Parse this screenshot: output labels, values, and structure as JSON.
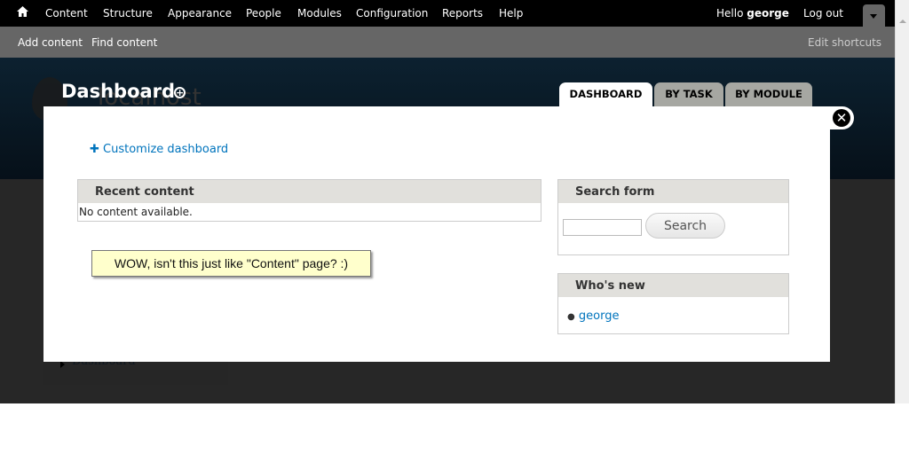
{
  "toolbar": {
    "menu": [
      "Content",
      "Structure",
      "Appearance",
      "People",
      "Modules",
      "Configuration",
      "Reports",
      "Help"
    ],
    "hello": "Hello",
    "username": "george",
    "logout": "Log out"
  },
  "shortcuts": {
    "items": [
      "Add content",
      "Find content"
    ],
    "edit": "Edit shortcuts"
  },
  "header": {
    "title": "Dashboard",
    "site_name": "localhost",
    "tabs": [
      "DASHBOARD",
      "BY TASK",
      "BY MODULE"
    ]
  },
  "background": {
    "breadcrumb": "Dashboard"
  },
  "overlay": {
    "customize": "Customize dashboard",
    "recent": {
      "title": "Recent content",
      "empty": "No content available."
    },
    "search": {
      "title": "Search form",
      "value": "",
      "button": "Search"
    },
    "whos_new": {
      "title": "Who's new",
      "users": [
        "george"
      ]
    }
  },
  "annotation": "WOW, isn't this just like \"Content\" page? :)"
}
